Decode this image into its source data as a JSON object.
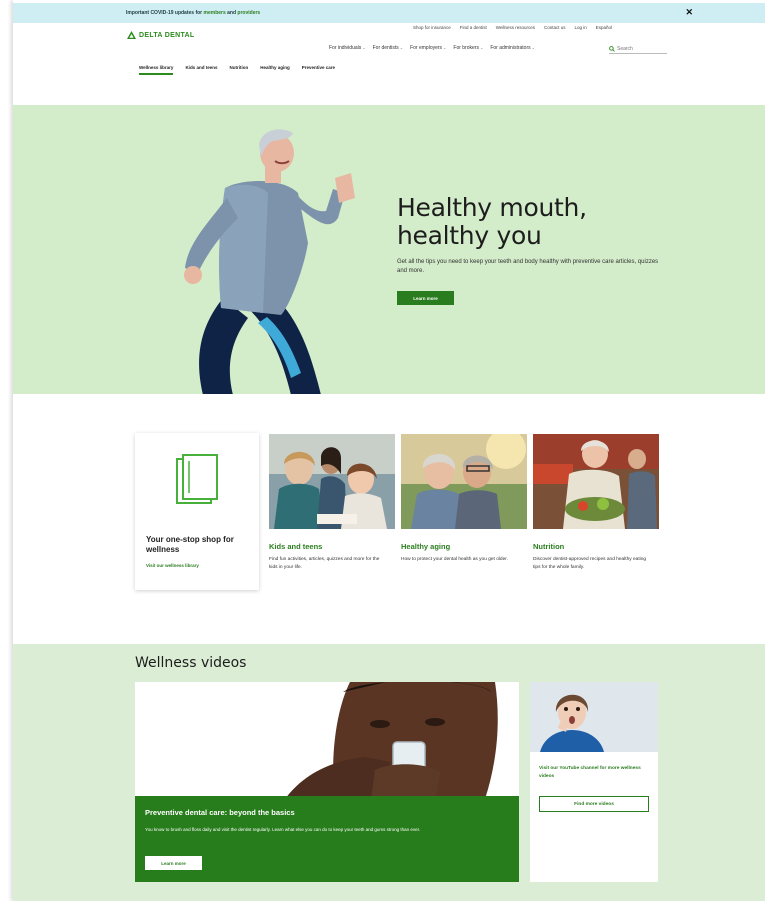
{
  "announcement": {
    "text": "Important COVID-19 updates for ",
    "link1": "members",
    "conj": " and ",
    "link2": "providers",
    "close": "✕"
  },
  "brand": {
    "name": "DELTA DENTAL"
  },
  "utility_nav": [
    "Shop for insurance",
    "Find a dentist",
    "Wellness resources",
    "Contact us",
    "Log in",
    "Español"
  ],
  "main_nav": [
    {
      "label": "For individuals"
    },
    {
      "label": "For dentists"
    },
    {
      "label": "For employers"
    },
    {
      "label": "For brokers"
    },
    {
      "label": "For administrators"
    }
  ],
  "search": {
    "placeholder": "Search",
    "icon": "search-icon"
  },
  "sub_nav": [
    "Wellness library",
    "Kids and teens",
    "Nutrition",
    "Healthy aging",
    "Preventive care"
  ],
  "hero": {
    "title_line1": "Healthy mouth,",
    "title_line2": "healthy you",
    "description": "Get all the tips you need to keep your teeth and body healthy with preventive care articles, quizzes and more.",
    "button": "Learn more",
    "bg_color": "#d3ecca"
  },
  "intro_card": {
    "title": "Your one-stop shop for wellness",
    "link": "Visit our wellness library",
    "icon": "book-icon"
  },
  "cards": [
    {
      "title": "Kids and teens",
      "text": "Find fun activities, articles, quizzes and more for the kids in your life."
    },
    {
      "title": "Healthy aging",
      "text": "How to protect your dental health as you get older."
    },
    {
      "title": "Nutrition",
      "text": "Discover dentist-approved recipes and healthy eating tips for the whole family."
    }
  ],
  "videos": {
    "heading": "Wellness videos",
    "feature_title": "Preventive dental care: beyond the basics",
    "feature_text": "You know to brush and floss daily and visit the dentist regularly. Learn what else you can do to keep your teeth and gums strong than ever.",
    "feature_button": "Learn more",
    "side_text": "Visit our YouTube channel for more wellness videos",
    "side_button": "Find more videos"
  },
  "colors": {
    "accent": "#2a7d1e",
    "announce_bg": "#cfeef3",
    "section_bg": "#dbedd4"
  }
}
